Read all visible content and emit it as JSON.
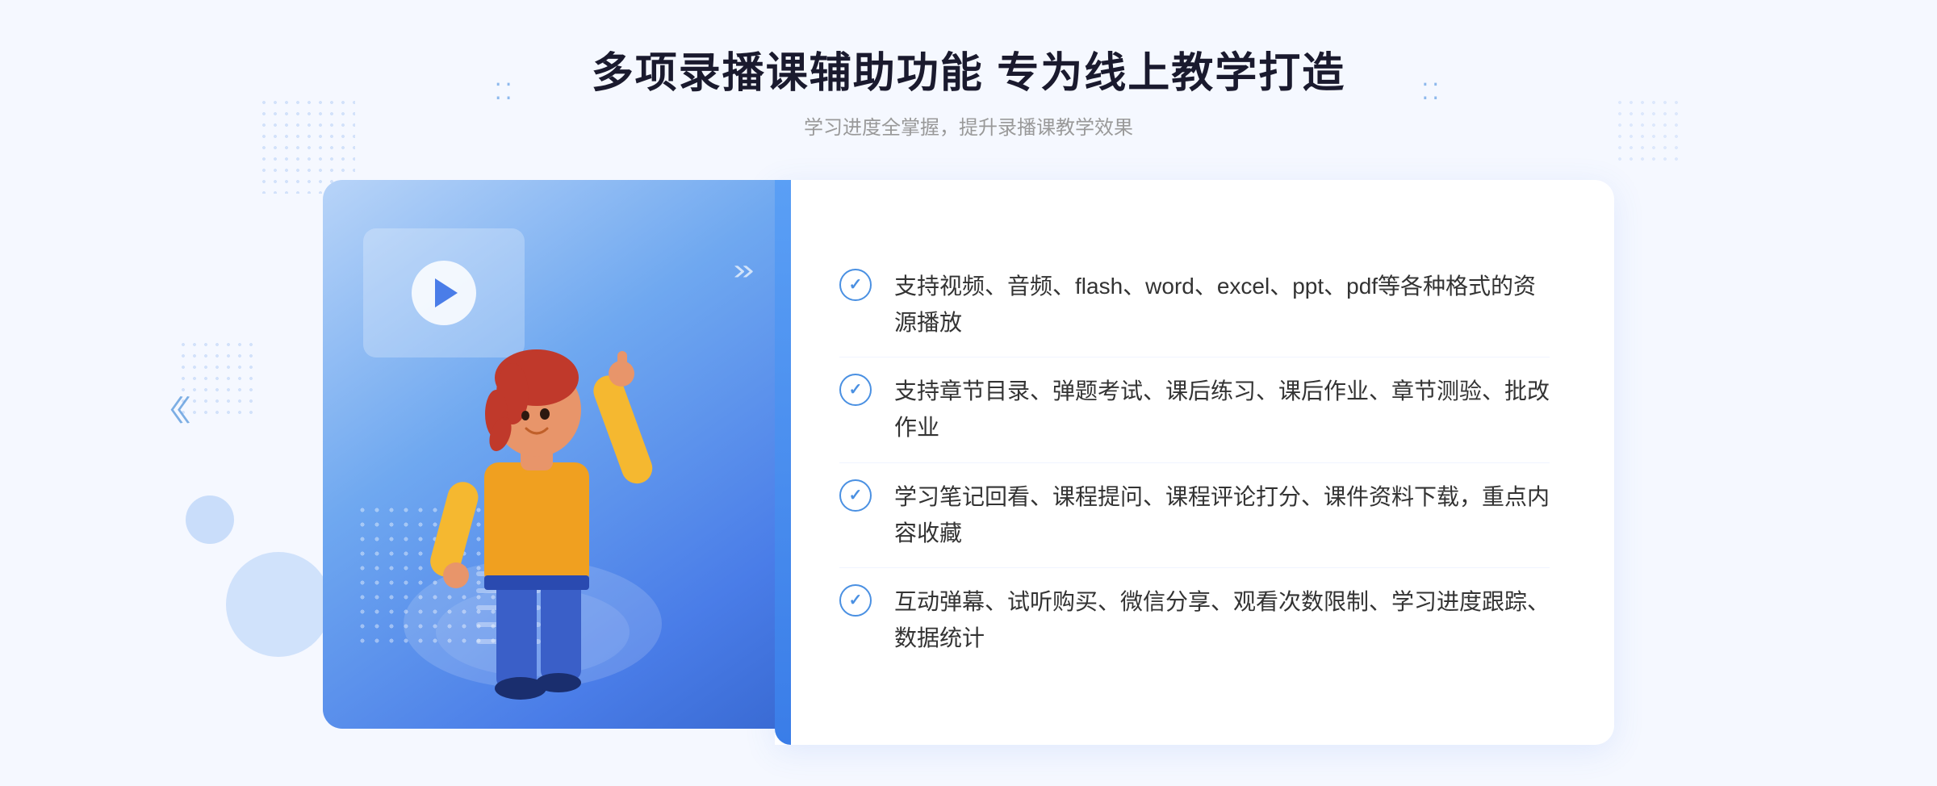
{
  "page": {
    "background_color": "#f5f8ff"
  },
  "header": {
    "main_title": "多项录播课辅助功能 专为线上教学打造",
    "sub_title": "学习进度全掌握，提升录播课教学效果",
    "deco_dots_label": "⁚⁚"
  },
  "features": [
    {
      "id": 1,
      "text": "支持视频、音频、flash、word、excel、ppt、pdf等各种格式的资源播放"
    },
    {
      "id": 2,
      "text": "支持章节目录、弹题考试、课后练习、课后作业、章节测验、批改作业"
    },
    {
      "id": 3,
      "text": "学习笔记回看、课程提问、课程评论打分、课件资料下载，重点内容收藏"
    },
    {
      "id": 4,
      "text": "互动弹幕、试听购买、微信分享、观看次数限制、学习进度跟踪、数据统计"
    }
  ],
  "illustration": {
    "card_gradient_start": "#b8d4f8",
    "card_gradient_end": "#3a6bd4"
  },
  "icons": {
    "play": "▶",
    "check": "✓",
    "arrows_left": "《",
    "arrows_deco": "»"
  }
}
